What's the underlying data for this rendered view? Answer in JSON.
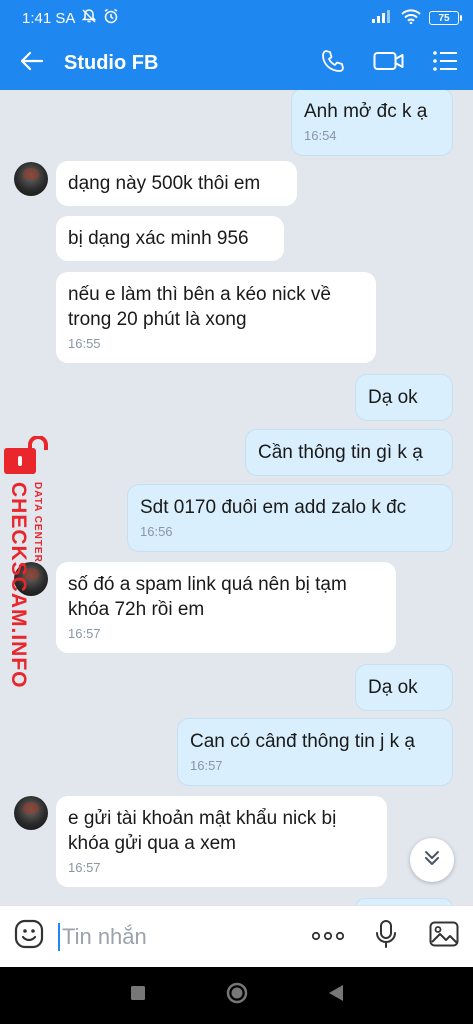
{
  "status_bar": {
    "time": "1:41 SA",
    "battery": "75",
    "icons": [
      "mute-bell-icon",
      "alarm-icon",
      "signal-icon",
      "wifi-icon",
      "battery-icon"
    ]
  },
  "header": {
    "title": "Studio FB",
    "icons": [
      "back-arrow-icon",
      "phone-icon",
      "video-call-icon",
      "menu-list-icon"
    ]
  },
  "messages": [
    {
      "side": "out",
      "text": "Anh mở đc k ạ",
      "time": "16:54"
    },
    {
      "side": "in",
      "text": "dạng này 500k thôi em",
      "time": ""
    },
    {
      "side": "in",
      "text": "bị dạng xác minh 956",
      "time": ""
    },
    {
      "side": "in",
      "text": "nếu e làm thì bên a kéo nick về trong 20 phút là xong",
      "time": "16:55"
    },
    {
      "side": "out",
      "text": "Dạ ok",
      "time": ""
    },
    {
      "side": "out",
      "text": "Cần thông tin gì k ạ",
      "time": ""
    },
    {
      "side": "out",
      "text": "Sdt 0170 đuôi em add zalo k đc",
      "time": "16:56"
    },
    {
      "side": "in",
      "text": "số đó a spam link quá nên bị tạm khóa 72h rồi em",
      "time": "16:57"
    },
    {
      "side": "out",
      "text": "Dạ ok",
      "time": ""
    },
    {
      "side": "out",
      "text": "Can có cânđ thông tin j k ạ",
      "time": "16:57"
    },
    {
      "side": "in",
      "text": "e gửi tài khoản mật khẩu nick bị khóa gửi qua a xem",
      "time": "16:57"
    }
  ],
  "watermark": {
    "main": "CHECKSCAM.INFO",
    "sub": "DATA CENTER"
  },
  "input": {
    "placeholder": "Tin nhắn",
    "icons": [
      "sticker-icon",
      "more-dots-icon",
      "microphone-icon",
      "image-icon"
    ]
  },
  "colors": {
    "header": "#1e88f0",
    "chat_bg": "#e2e7ee",
    "incoming": "#ffffff",
    "outgoing": "#d9effd",
    "watermark": "#e8262b"
  }
}
